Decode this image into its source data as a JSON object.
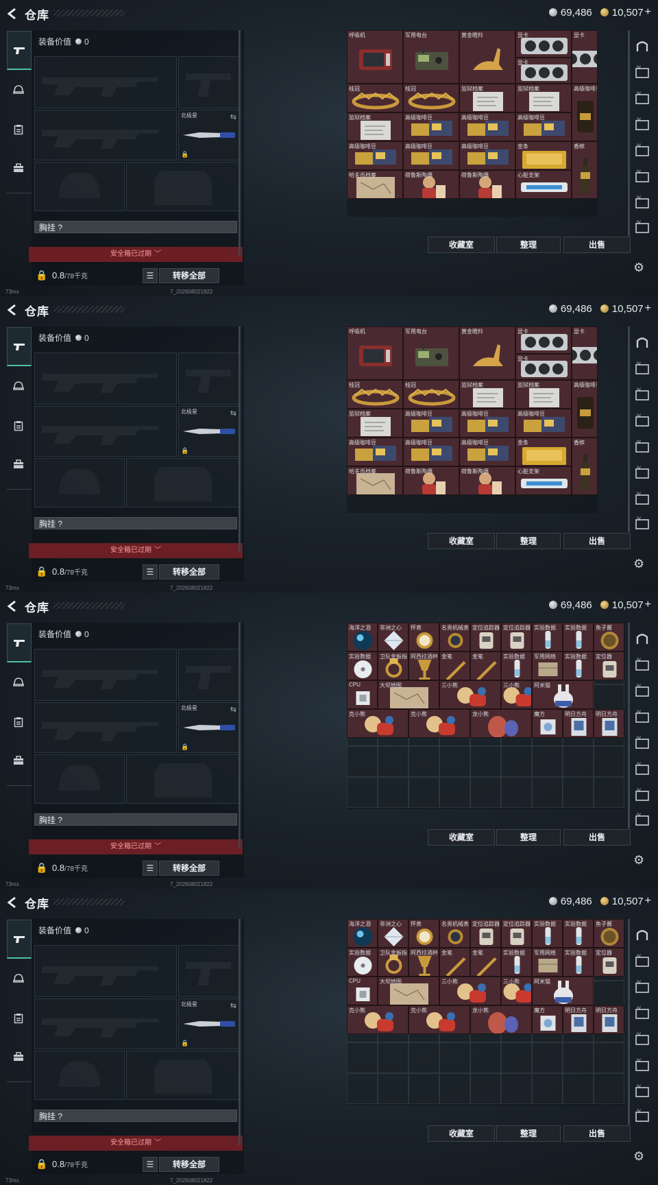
{
  "title": "仓库",
  "currency": {
    "silver": "69,486",
    "gold": "10,507",
    "plus": "+"
  },
  "equip_value_label": "装备价值",
  "equip_value": "0",
  "knife_label": "北极星",
  "rig_label": "胸挂 ?",
  "safebox_text": "安全箱已过期",
  "weight": {
    "value": "0.8",
    "max": "/78千克"
  },
  "transfer_all": "转移全部",
  "buttons": {
    "collection": "收藏室",
    "sort": "整理",
    "sell": "出售"
  },
  "status": {
    "ping": "73ms",
    "version": "7_202608021822"
  },
  "icons": {
    "back": "back-arrow-icon",
    "tabs": [
      "gun-icon",
      "helmet-icon",
      "clipboard-icon",
      "briefcase-icon"
    ],
    "right_tabs": [
      "home-safe-icon",
      "tv-icon",
      "tv-icon",
      "tv-icon",
      "tv-icon",
      "tv-icon",
      "tv-icon",
      "tv-icon"
    ]
  },
  "colors": {
    "accent": "#4ec3a5",
    "red_cell": "#4a2a30",
    "safebox": "#6b1f24"
  },
  "panels": [
    {
      "items": [
        {
          "label": "呼吸机",
          "art": "ventilator"
        },
        {
          "label": "军用电台",
          "art": "radio"
        },
        {
          "label": "黄金瞪羚",
          "art": "gazelle"
        },
        {
          "label": "显卡",
          "art": "gpu"
        },
        {
          "label": "显卡",
          "art": "gpu"
        },
        {
          "label": "显卡",
          "art": "gpu"
        },
        {
          "label": "桂冠",
          "art": "crown"
        },
        {
          "label": "桂冠",
          "art": "crown"
        },
        {
          "label": "监狱档案",
          "art": "paper"
        },
        {
          "label": "监狱档案",
          "art": "paper"
        },
        {
          "label": "高级咖啡豆",
          "art": "coffee-bag"
        },
        {
          "label": "监狱档案",
          "art": "paper"
        },
        {
          "label": "高级咖啡豆",
          "art": "coffee"
        },
        {
          "label": "高级咖啡豆",
          "art": "coffee"
        },
        {
          "label": "高级咖啡豆",
          "art": "coffee"
        },
        {
          "label": "高级咖啡豆",
          "art": "coffee"
        },
        {
          "label": "高级咖啡豆",
          "art": "coffee"
        },
        {
          "label": "高级咖啡豆",
          "art": "coffee"
        },
        {
          "label": "金条",
          "art": "gold-bar"
        },
        {
          "label": "香槟",
          "art": "champagne"
        },
        {
          "label": "哈夫币档案",
          "art": "map"
        },
        {
          "label": "荷鲁斯陶偶",
          "art": "figure"
        },
        {
          "label": "荷鲁斯陶偶",
          "art": "figure"
        },
        {
          "label": "心脏支架",
          "art": "stent"
        }
      ]
    },
    {
      "items": [
        {
          "label": "呼吸机",
          "art": "ventilator"
        },
        {
          "label": "军用电台",
          "art": "radio"
        },
        {
          "label": "黄金瞪羚",
          "art": "gazelle"
        },
        {
          "label": "显卡",
          "art": "gpu"
        },
        {
          "label": "显卡",
          "art": "gpu"
        },
        {
          "label": "显卡",
          "art": "gpu"
        },
        {
          "label": "桂冠",
          "art": "crown"
        },
        {
          "label": "桂冠",
          "art": "crown"
        },
        {
          "label": "监狱档案",
          "art": "paper"
        },
        {
          "label": "监狱档案",
          "art": "paper"
        },
        {
          "label": "高级咖啡豆",
          "art": "coffee-bag"
        },
        {
          "label": "监狱档案",
          "art": "paper"
        },
        {
          "label": "高级咖啡豆",
          "art": "coffee"
        },
        {
          "label": "高级咖啡豆",
          "art": "coffee"
        },
        {
          "label": "高级咖啡豆",
          "art": "coffee"
        },
        {
          "label": "高级咖啡豆",
          "art": "coffee"
        },
        {
          "label": "高级咖啡豆",
          "art": "coffee"
        },
        {
          "label": "高级咖啡豆",
          "art": "coffee"
        },
        {
          "label": "金条",
          "art": "gold-bar"
        },
        {
          "label": "香槟",
          "art": "champagne"
        },
        {
          "label": "哈夫币档案",
          "art": "map"
        },
        {
          "label": "荷鲁斯陶偶",
          "art": "figure"
        },
        {
          "label": "荷鲁斯陶偶",
          "art": "figure"
        },
        {
          "label": "心脏支架",
          "art": "stent"
        }
      ]
    },
    {
      "items": [
        {
          "label": "海洋之泪",
          "art": "orb"
        },
        {
          "label": "非洲之心",
          "art": "diamond"
        },
        {
          "label": "怀表",
          "art": "pocket-watch"
        },
        {
          "label": "名贵机械表",
          "art": "watch"
        },
        {
          "label": "定位追踪器",
          "art": "tracker"
        },
        {
          "label": "定位追踪器",
          "art": "tracker"
        },
        {
          "label": "实验数据",
          "art": "vial"
        },
        {
          "label": "实验数据",
          "art": "vial"
        },
        {
          "label": "鱼子酱",
          "art": "tin"
        },
        {
          "label": "实验数据",
          "art": "disc"
        },
        {
          "label": "卫队金板指",
          "art": "ring"
        },
        {
          "label": "阿西拉酒杯",
          "art": "goblet"
        },
        {
          "label": "金笔",
          "art": "pen"
        },
        {
          "label": "金笔",
          "art": "pen"
        },
        {
          "label": "实验数据",
          "art": "vial"
        },
        {
          "label": "军用网络",
          "art": "box"
        },
        {
          "label": "实验数据",
          "art": "vial"
        },
        {
          "label": "定位器",
          "art": "tracker"
        },
        {
          "label": "CPU",
          "art": "cpu"
        },
        {
          "label": "大坝地图",
          "art": "map"
        },
        {
          "label": "三小熊",
          "art": "bear"
        },
        {
          "label": "三小熊",
          "art": "bear"
        },
        {
          "label": "阿米猫",
          "art": "bunny"
        },
        {
          "label": "克小熊",
          "art": "bear"
        },
        {
          "label": "克小熊",
          "art": "bear"
        },
        {
          "label": "龙小熊",
          "art": "egg"
        },
        {
          "label": "魔方",
          "art": "cube"
        },
        {
          "label": "明日方舟",
          "art": "card"
        },
        {
          "label": "明日方舟",
          "art": "card"
        }
      ]
    },
    {
      "items": [
        {
          "label": "海洋之泪",
          "art": "orb"
        },
        {
          "label": "非洲之心",
          "art": "diamond"
        },
        {
          "label": "怀表",
          "art": "pocket-watch"
        },
        {
          "label": "名贵机械表",
          "art": "watch"
        },
        {
          "label": "定位追踪器",
          "art": "tracker"
        },
        {
          "label": "定位追踪器",
          "art": "tracker"
        },
        {
          "label": "实验数据",
          "art": "vial"
        },
        {
          "label": "实验数据",
          "art": "vial"
        },
        {
          "label": "鱼子酱",
          "art": "tin"
        },
        {
          "label": "实验数据",
          "art": "disc"
        },
        {
          "label": "卫队金板指",
          "art": "ring"
        },
        {
          "label": "阿西拉酒杯",
          "art": "goblet"
        },
        {
          "label": "金笔",
          "art": "pen"
        },
        {
          "label": "金笔",
          "art": "pen"
        },
        {
          "label": "实验数据",
          "art": "vial"
        },
        {
          "label": "军用网络",
          "art": "box"
        },
        {
          "label": "实验数据",
          "art": "vial"
        },
        {
          "label": "定位器",
          "art": "tracker"
        },
        {
          "label": "CPU",
          "art": "cpu"
        },
        {
          "label": "大坝地图",
          "art": "map"
        },
        {
          "label": "三小熊",
          "art": "bear"
        },
        {
          "label": "三小熊",
          "art": "bear"
        },
        {
          "label": "阿米猫",
          "art": "bunny"
        },
        {
          "label": "克小熊",
          "art": "bear"
        },
        {
          "label": "克小熊",
          "art": "bear"
        },
        {
          "label": "龙小熊",
          "art": "egg"
        },
        {
          "label": "魔方",
          "art": "cube"
        },
        {
          "label": "明日方舟",
          "art": "card"
        },
        {
          "label": "明日方舟",
          "art": "card"
        }
      ]
    }
  ]
}
